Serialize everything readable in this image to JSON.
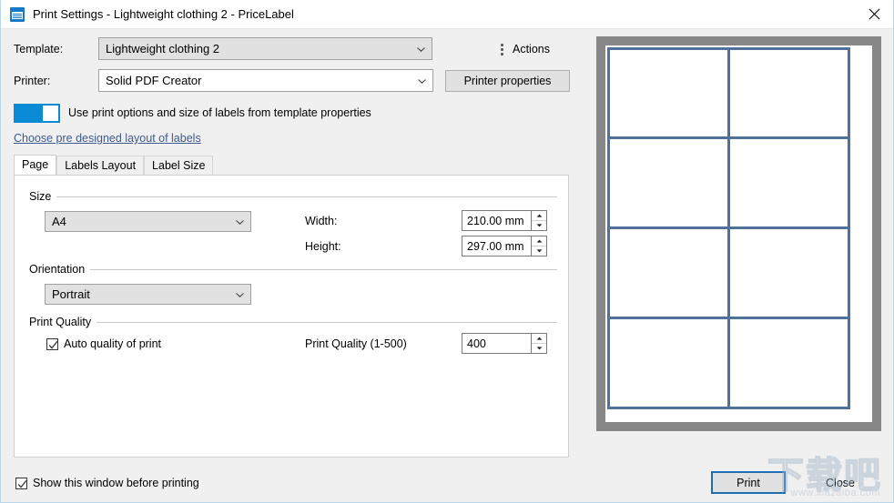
{
  "window": {
    "title": "Print Settings - Lightweight clothing 2 - PriceLabel",
    "icon": "printer-icon",
    "close_icon": "close-icon"
  },
  "form": {
    "template_label": "Template:",
    "template_value": "Lightweight clothing 2",
    "printer_label": "Printer:",
    "printer_value": "Solid PDF Creator",
    "printer_properties_button": "Printer properties",
    "actions_label": "Actions",
    "actions_icon": "kebab-menu-icon",
    "toggle_label": "Use print options and size of labels from template properties",
    "toggle_state": "on",
    "layout_link": "Choose pre designed layout of labels"
  },
  "tabs": [
    {
      "label": "Page",
      "active": true
    },
    {
      "label": "Labels Layout",
      "active": false
    },
    {
      "label": "Label Size",
      "active": false
    }
  ],
  "page_tab": {
    "size_group": "Size",
    "size_value": "A4",
    "width_label": "Width:",
    "width_value": "210.00 mm",
    "height_label": "Height:",
    "height_value": "297.00 mm",
    "orientation_group": "Orientation",
    "orientation_value": "Portrait",
    "print_quality_group": "Print Quality",
    "auto_quality_label": "Auto quality of print",
    "auto_quality_checked": true,
    "print_quality_label": "Print Quality (1-500)",
    "print_quality_value": "400"
  },
  "preview": {
    "columns": 2,
    "rows": 4,
    "label_border_color": "#4e729a",
    "frame_color": "#878787",
    "page_color": "#ffffff"
  },
  "footer": {
    "show_window_label": "Show this window before printing",
    "show_window_checked": true,
    "print_button": "Print",
    "close_button": "Close"
  },
  "watermark": {
    "chinese": "下载吧",
    "url": "www.xiazaiba.com"
  },
  "colors": {
    "accent": "#0b8ad5",
    "focus_border": "#1e6eb4",
    "link": "#3f5b8a",
    "dialog_bg": "#f0f0f0"
  }
}
